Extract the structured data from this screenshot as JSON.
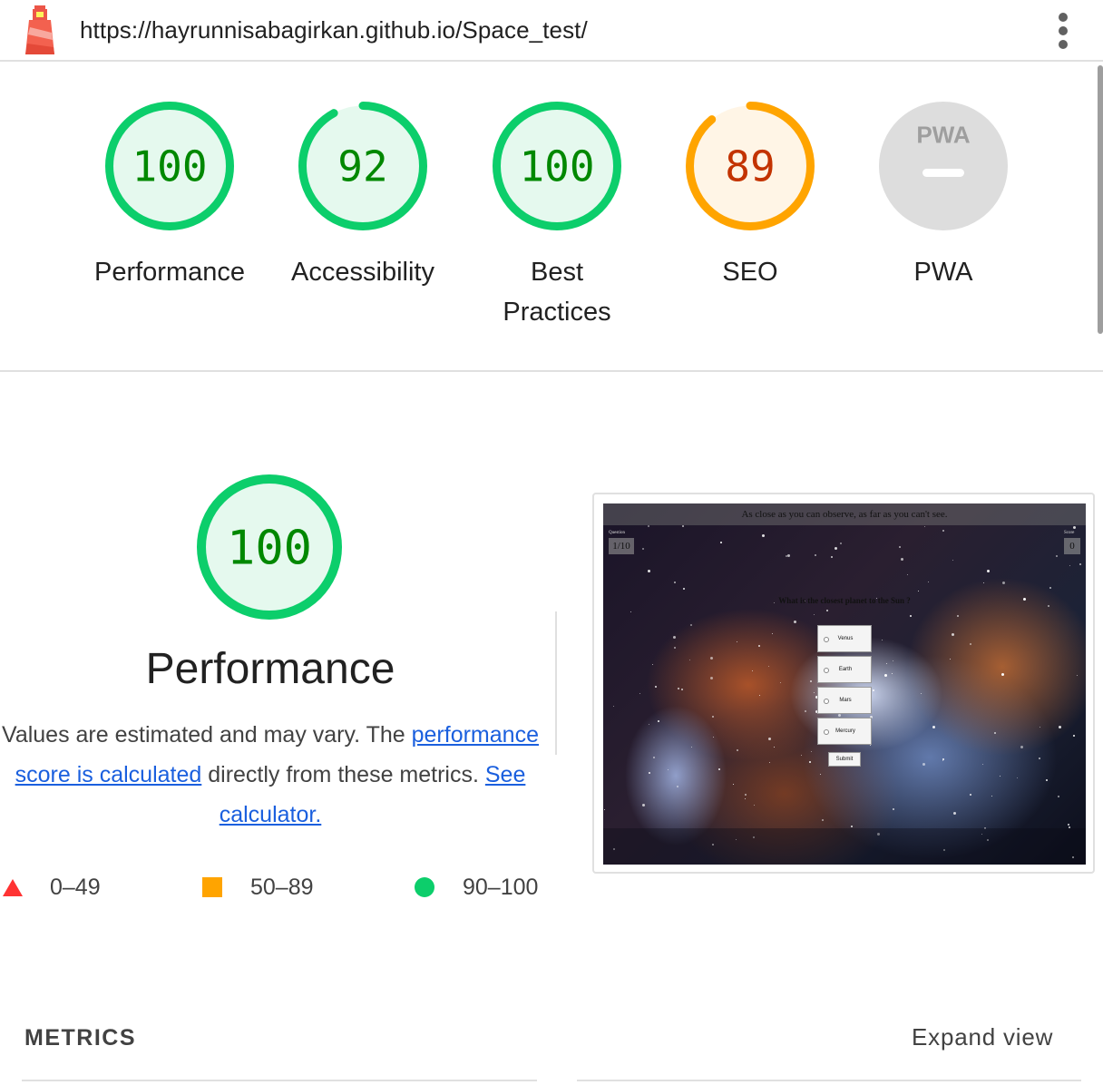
{
  "topbar": {
    "url": "https://hayrunnisabagirkan.github.io/Space_test/"
  },
  "colors": {
    "pass": "#0cce6b",
    "pass_text": "#008800",
    "pass_fill": "#e5f9ee",
    "average": "#ffa400",
    "average_text": "#c33300",
    "average_fill": "#fff5e6",
    "fail": "#ff3333",
    "na_fill": "#dddddd",
    "link": "#1a5fde"
  },
  "gauges": [
    {
      "score": "100",
      "label": "Performance",
      "value": 100,
      "rating": "pass"
    },
    {
      "score": "92",
      "label": "Accessibility",
      "value": 92,
      "rating": "pass"
    },
    {
      "score": "100",
      "label": "Best Practices",
      "value": 100,
      "rating": "pass"
    },
    {
      "score": "89",
      "label": "SEO",
      "value": 89,
      "rating": "average"
    },
    {
      "score": "",
      "label": "PWA",
      "badge": "PWA",
      "rating": "na"
    }
  ],
  "performance": {
    "score": "100",
    "title": "Performance",
    "desc_prefix": "Values are estimated and may vary. The ",
    "link1": "performance score is calculated",
    "desc_middle": " directly from these metrics. ",
    "link2": "See calculator."
  },
  "legend": [
    {
      "shape": "triangle",
      "range": "0–49"
    },
    {
      "shape": "square",
      "range": "50–89"
    },
    {
      "shape": "circle",
      "range": "90–100"
    }
  ],
  "screenshot": {
    "banner": "As close as you can observe, as far as you can't see.",
    "question_label": "Question",
    "question_counter": "1/10",
    "score_label": "Score",
    "score_value": "0",
    "question": "What is the closest planet to the Sun ?",
    "options": [
      "Venus",
      "Earth",
      "Mars",
      "Mercury"
    ],
    "submit": "Submit"
  },
  "metrics": {
    "title": "METRICS",
    "expand": "Expand view"
  }
}
